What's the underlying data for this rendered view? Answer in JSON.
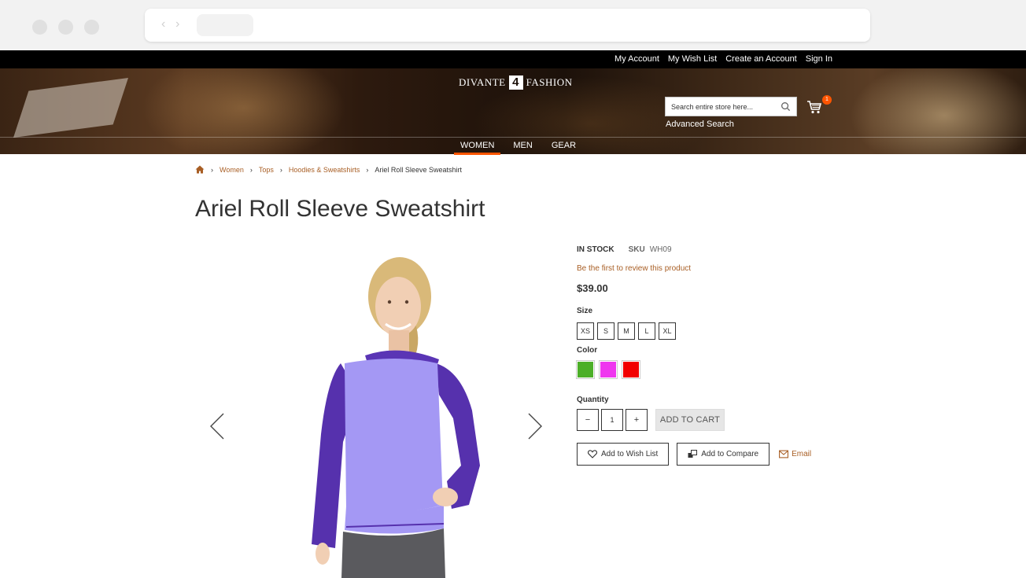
{
  "top_links": [
    "My Account",
    "My Wish List",
    "Create an Account",
    "Sign In"
  ],
  "logo": {
    "left": "DIVANTE",
    "mark": "4",
    "right": "FASHION"
  },
  "search": {
    "placeholder": "Search entire store here...",
    "advanced": "Advanced Search"
  },
  "cart": {
    "count": "1"
  },
  "nav": {
    "items": [
      "WOMEN",
      "MEN",
      "GEAR"
    ],
    "active": "WOMEN"
  },
  "breadcrumb": [
    "Women",
    "Tops",
    "Hoodies & Sweatshirts",
    "Ariel Roll Sleeve Sweatshirt"
  ],
  "product": {
    "title": "Ariel Roll Sleeve Sweatshirt",
    "stock": "IN STOCK",
    "sku_label": "SKU",
    "sku": "WH09",
    "review_link": "Be the first to review this product",
    "price": "$39.00",
    "size_label": "Size",
    "sizes": [
      "XS",
      "S",
      "M",
      "L",
      "XL"
    ],
    "color_label": "Color",
    "colors": [
      "#4caf28",
      "#ef37ef",
      "#f20000"
    ],
    "quantity_label": "Quantity",
    "quantity": "1",
    "add_to_cart": "ADD TO CART",
    "wishlist": "Add to Wish List",
    "compare": "Add to Compare",
    "email": "Email"
  },
  "colors": {
    "accent": "#ff5501",
    "link": "#a85e24"
  }
}
